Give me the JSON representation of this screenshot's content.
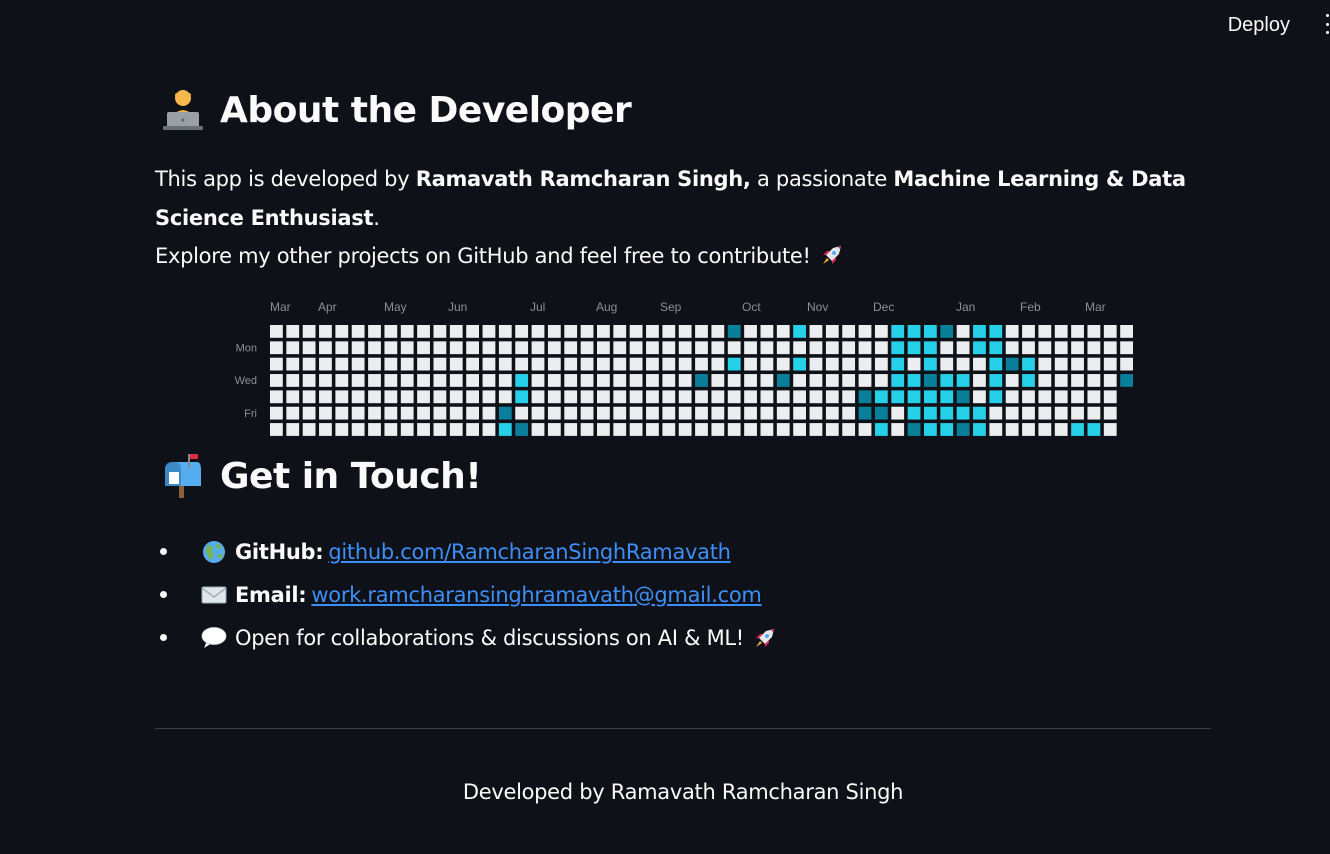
{
  "topbar": {
    "deploy_label": "Deploy"
  },
  "about": {
    "icon": "technologist-emoji-icon",
    "title": "About the Developer",
    "intro_prefix": "This app is developed by ",
    "developer_name": "Ramavath Ramcharan Singh,",
    "intro_middle": " a passionate ",
    "role": "Machine Learning & Data Science Enthusiast",
    "intro_suffix": ".",
    "explore_text": "Explore my other projects on GitHub and feel free to contribute!",
    "explore_icon": "rocket-icon"
  },
  "contributions": {
    "months": [
      "Mar",
      "Apr",
      "May",
      "Jun",
      "Jul",
      "Aug",
      "Sep",
      "Oct",
      "Nov",
      "Dec",
      "Jan",
      "Feb",
      "Mar"
    ],
    "day_labels": [
      "Mon",
      "Wed",
      "Fri"
    ],
    "weeks": 53,
    "colors": {
      "empty": "#ebedf0",
      "level1": "#26d0e8",
      "level2": "#55eeff",
      "level3": "#0a7f99"
    }
  },
  "contact": {
    "icon": "mailbox-emoji-icon",
    "title": "Get in Touch!",
    "items": [
      {
        "icon": "globe-icon",
        "label": "GitHub:",
        "link": "github.com/RamcharanSinghRamavath"
      },
      {
        "icon": "envelope-icon",
        "label": "Email:",
        "link": "work.ramcharansinghramavath@gmail.com"
      },
      {
        "icon": "speech-bubble-icon",
        "text": "Open for collaborations & discussions on AI & ML!",
        "trail_icon": "rocket-icon"
      }
    ]
  },
  "footer": {
    "text": "Developed by Ramavath Ramcharan Singh"
  }
}
